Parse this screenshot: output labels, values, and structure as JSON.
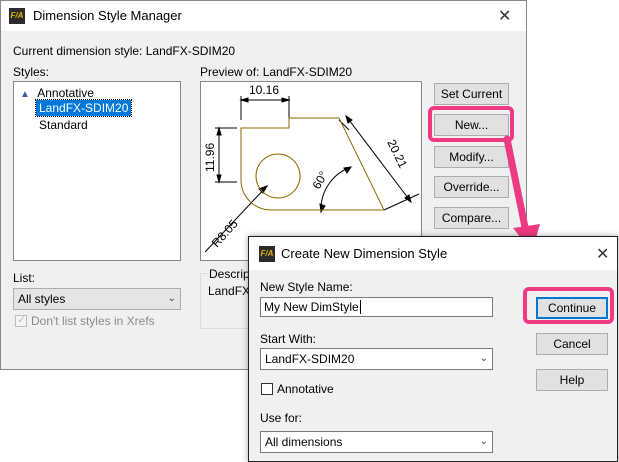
{
  "manager": {
    "title": "Dimension Style Manager",
    "app_icon": "F/A",
    "current_style_prefix": "Current dimension style: ",
    "current_style": "LandFX-SDIM20",
    "styles_label": "Styles:",
    "styles": [
      "Annotative",
      "LandFX-SDIM20",
      "Standard"
    ],
    "selected_style": "LandFX-SDIM20",
    "preview_label": "Preview of: LandFX-SDIM20",
    "list_label": "List:",
    "list_value": "All styles",
    "dont_list_label": "Don't list styles in Xrefs",
    "description_label": "Descripti",
    "description_value": "LandFX-",
    "buttons": {
      "set_current": "Set Current",
      "new": "New...",
      "modify": "Modify...",
      "override": "Override...",
      "compare": "Compare..."
    },
    "preview_dims": {
      "top": "10.16",
      "left": "11.96",
      "diag": "20.21",
      "angle": "60°",
      "radius": "R8.05"
    }
  },
  "create": {
    "title": "Create New Dimension Style",
    "app_icon": "F/A",
    "new_name_label": "New Style Name:",
    "new_name_value": "My New DimStyle",
    "start_with_label": "Start With:",
    "start_with_value": "LandFX-SDIM20",
    "annotative_label": "Annotative",
    "use_for_label": "Use for:",
    "use_for_value": "All dimensions",
    "buttons": {
      "continue": "Continue",
      "cancel": "Cancel",
      "help": "Help"
    }
  },
  "colors": {
    "highlight": "#ec3b83",
    "selection": "#0078d7",
    "preview_geometry": "#8b6a00"
  }
}
